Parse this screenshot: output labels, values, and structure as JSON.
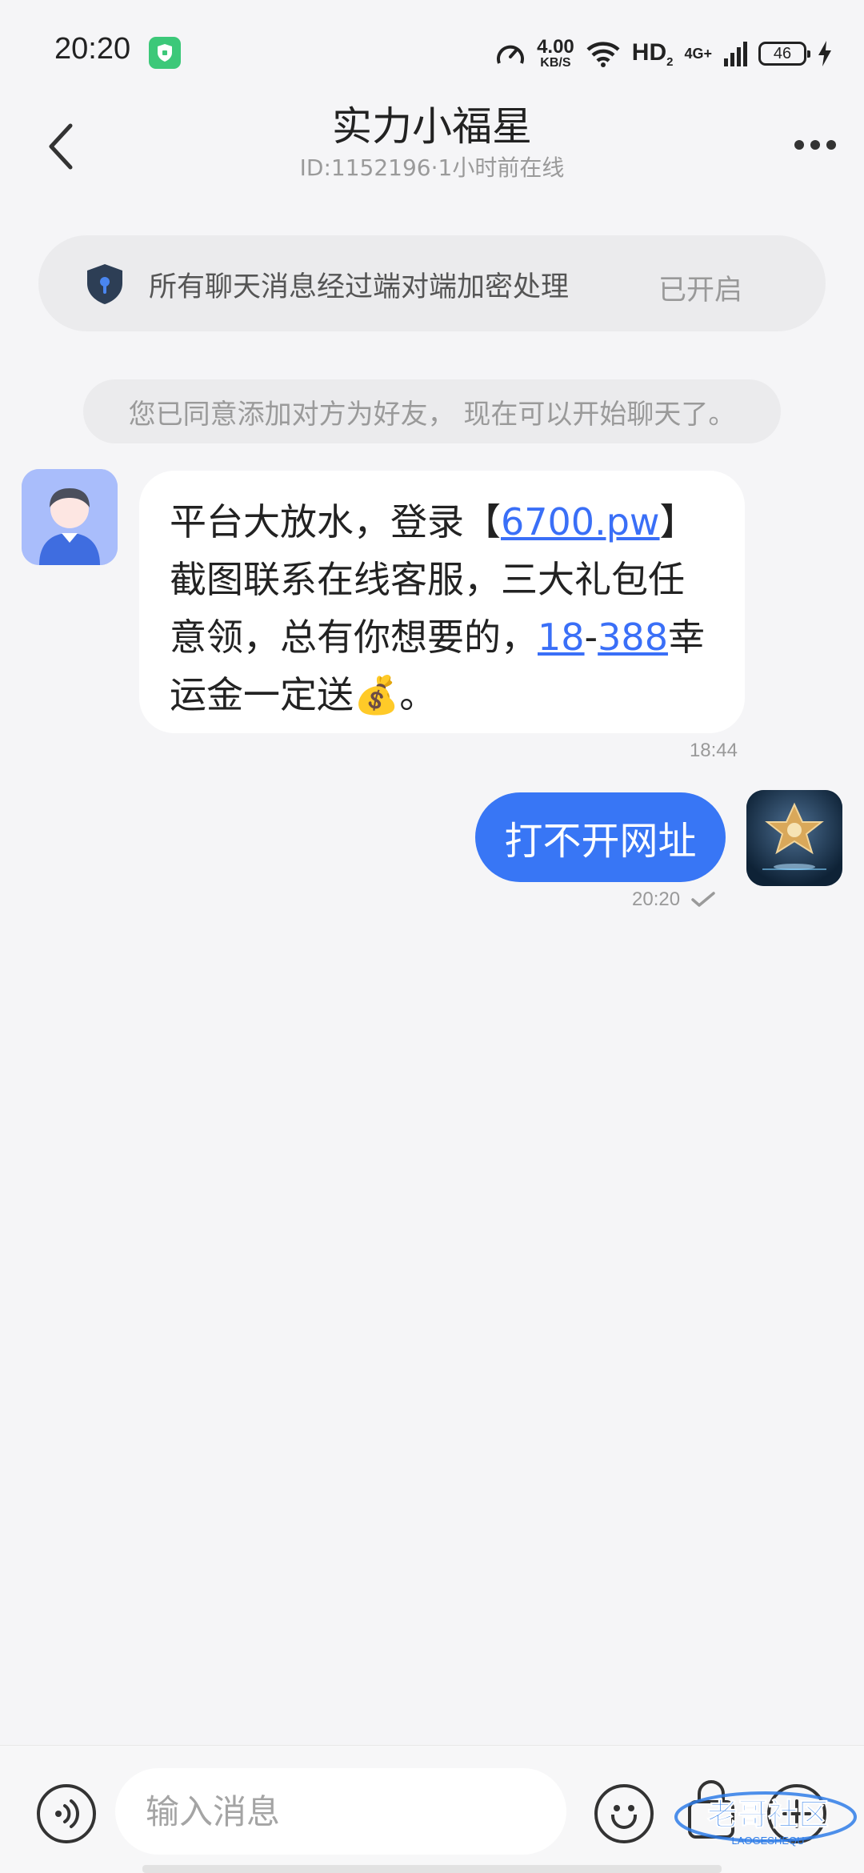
{
  "status_bar": {
    "time": "20:20",
    "speed_value": "4.00",
    "speed_unit": "KB/S",
    "hd_label": "HD",
    "hd_sub": "2",
    "network": "4G+",
    "battery": "46"
  },
  "header": {
    "title": "实力小福星",
    "subtitle": "ID:1152196·1小时前在线"
  },
  "encryption_banner": {
    "text": "所有聊天消息经过端对端加密处理",
    "status": "已开启"
  },
  "system_notice": "您已同意添加对方为好友， 现在可以开始聊天了。",
  "messages": [
    {
      "direction": "incoming",
      "parts": {
        "t1": "平台大放水，登录【",
        "link1": "6700.pw",
        "t2": "】截图联系在线客服，三大礼包任意领，总有你想要的，",
        "link2": "18",
        "t3": "-",
        "link3": "388",
        "t4": "幸运金一定送",
        "emoji": "💰",
        "t5": "。"
      },
      "time": "18:44"
    },
    {
      "direction": "outgoing",
      "text": "打不开网址",
      "time": "20:20"
    }
  ],
  "input": {
    "placeholder": "输入消息"
  },
  "watermark": {
    "main": "老哥社区",
    "sub": "LAOGESHEQU"
  },
  "colors": {
    "accent": "#3876f5",
    "link": "#3a6ff7",
    "background": "#f5f5f7",
    "banner": "#ebebed"
  }
}
